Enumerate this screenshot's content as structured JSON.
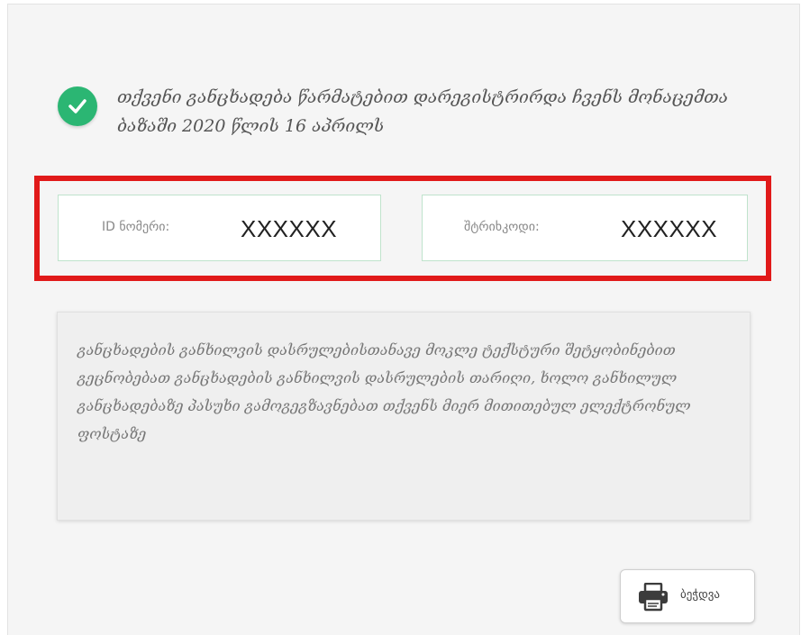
{
  "success": {
    "icon": "check-circle-icon",
    "icon_color": "#2bb673",
    "message": "თქვენი განცხადება წარმატებით დარეგისტრირდა ჩვენს მონაცემთა ბაზაში 2020 წლის 16 აპრილს"
  },
  "credentials": {
    "highlight_color": "#e11a1a",
    "id_label": "ID ნომერი:",
    "id_value": "XXXXXX",
    "code_label": "შტრიხკოდი:",
    "code_value": "XXXXXX"
  },
  "info": {
    "text": "განცხადების განხილვის დასრულებისთანავე მოკლე ტექსტური შეტყობინებით გეცნობებათ განცხადების განხილვის დასრულების თარიღი, ხოლო განხილულ განცხადებაზე პასუხი გამოგეგზავნებათ თქვენს მიერ მითითებულ ელექტრონულ ფოსტაზე"
  },
  "actions": {
    "print_label": "ბეჭდვა",
    "print_icon": "printer-icon"
  }
}
